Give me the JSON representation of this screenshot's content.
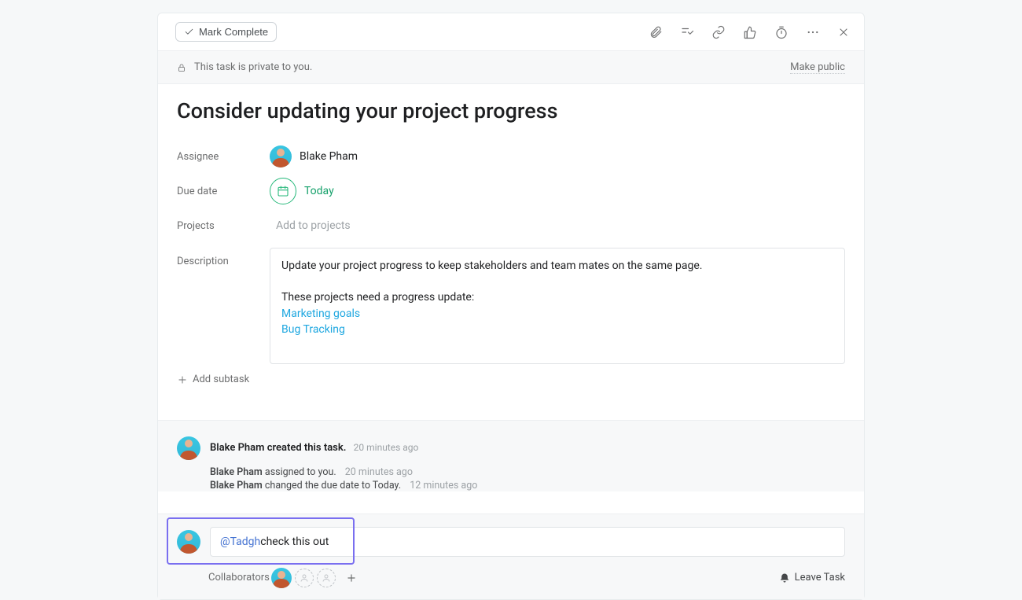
{
  "toolbar": {
    "complete_label": "Mark Complete"
  },
  "privacy": {
    "message": "This task is private to you.",
    "make_public_label": "Make public"
  },
  "task": {
    "title": "Consider updating your project progress"
  },
  "fields": {
    "assignee_label": "Assignee",
    "assignee_name": "Blake Pham",
    "due_label": "Due date",
    "due_value": "Today",
    "projects_label": "Projects",
    "add_to_projects": "Add to projects",
    "description_label": "Description"
  },
  "description": {
    "line1": "Update your project progress to keep stakeholders and team mates on the same page.",
    "line2": "These projects need a progress update:",
    "links": [
      "Marketing goals",
      "Bug Tracking"
    ]
  },
  "subtask": {
    "add_label": "Add subtask"
  },
  "activity": {
    "created": {
      "actor": "Blake Pham",
      "text": "created this task.",
      "time": "20 minutes ago"
    },
    "events": [
      {
        "actor": "Blake Pham",
        "text": "assigned to you.",
        "time": "20 minutes ago"
      },
      {
        "actor": "Blake Pham",
        "text": "changed the due date to Today.",
        "time": "12 minutes ago"
      }
    ]
  },
  "comment": {
    "mention": "@Tadgh",
    "rest": " check this out"
  },
  "footer": {
    "collaborators_label": "Collaborators",
    "leave_label": "Leave Task"
  }
}
